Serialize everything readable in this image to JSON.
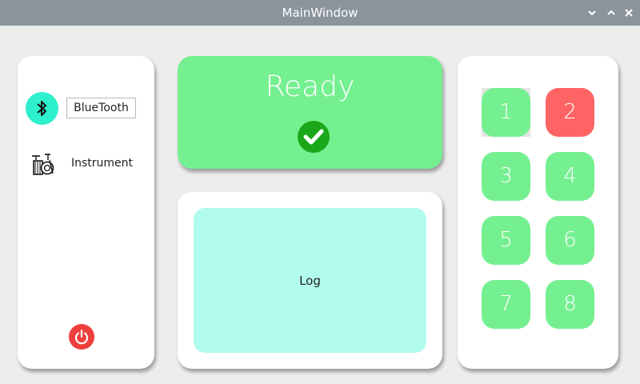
{
  "window": {
    "title": "MainWindow",
    "controls": [
      "minimize-icon",
      "maximize-icon",
      "close-icon"
    ]
  },
  "sidebar": {
    "bluetooth_icon": "bluetooth-icon",
    "bluetooth_label": "BlueTooth",
    "instrument_icon": "drum-kit-icon",
    "instrument_label": "Instrument",
    "power_icon": "power-icon"
  },
  "status": {
    "text": "Ready",
    "icon": "check-circle-icon"
  },
  "log": {
    "label": "Log"
  },
  "keypad": {
    "keys": [
      {
        "label": "1",
        "state": "normal"
      },
      {
        "label": "2",
        "state": "active"
      },
      {
        "label": "3",
        "state": "normal"
      },
      {
        "label": "4",
        "state": "normal"
      },
      {
        "label": "5",
        "state": "normal"
      },
      {
        "label": "6",
        "state": "normal"
      },
      {
        "label": "7",
        "state": "normal"
      },
      {
        "label": "8",
        "state": "normal"
      }
    ]
  },
  "colors": {
    "titlebar": "#8a949c",
    "ready_green": "#75f090",
    "bluetooth_teal": "#2ff0cc",
    "log_background": "#b1fcec",
    "active_key_red": "#ff6464",
    "power_red": "#ee3f3c",
    "check_green": "#1aa81a"
  }
}
